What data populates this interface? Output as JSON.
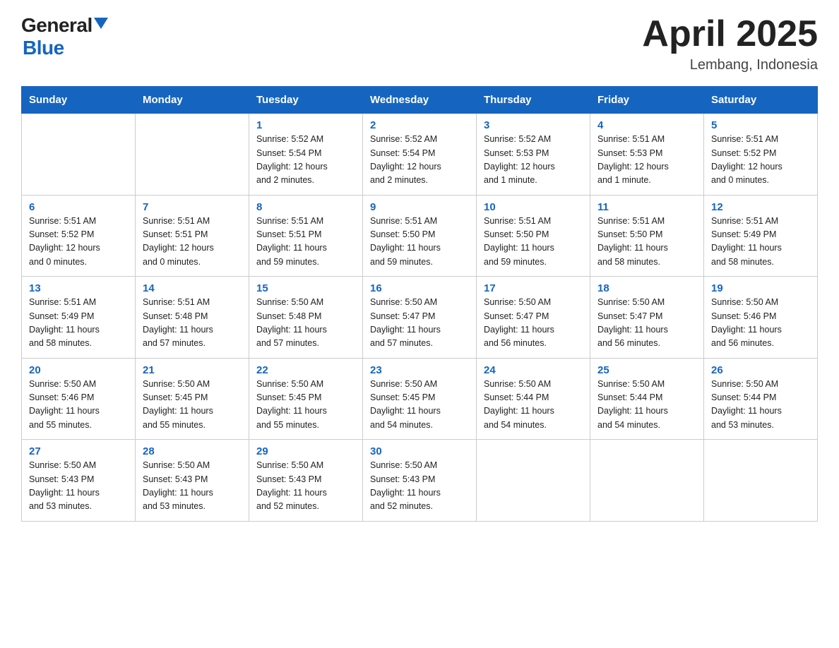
{
  "header": {
    "logo_general": "General",
    "logo_blue": "Blue",
    "title": "April 2025",
    "location": "Lembang, Indonesia"
  },
  "weekdays": [
    "Sunday",
    "Monday",
    "Tuesday",
    "Wednesday",
    "Thursday",
    "Friday",
    "Saturday"
  ],
  "weeks": [
    [
      {
        "day": "",
        "info": ""
      },
      {
        "day": "",
        "info": ""
      },
      {
        "day": "1",
        "info": "Sunrise: 5:52 AM\nSunset: 5:54 PM\nDaylight: 12 hours\nand 2 minutes."
      },
      {
        "day": "2",
        "info": "Sunrise: 5:52 AM\nSunset: 5:54 PM\nDaylight: 12 hours\nand 2 minutes."
      },
      {
        "day": "3",
        "info": "Sunrise: 5:52 AM\nSunset: 5:53 PM\nDaylight: 12 hours\nand 1 minute."
      },
      {
        "day": "4",
        "info": "Sunrise: 5:51 AM\nSunset: 5:53 PM\nDaylight: 12 hours\nand 1 minute."
      },
      {
        "day": "5",
        "info": "Sunrise: 5:51 AM\nSunset: 5:52 PM\nDaylight: 12 hours\nand 0 minutes."
      }
    ],
    [
      {
        "day": "6",
        "info": "Sunrise: 5:51 AM\nSunset: 5:52 PM\nDaylight: 12 hours\nand 0 minutes."
      },
      {
        "day": "7",
        "info": "Sunrise: 5:51 AM\nSunset: 5:51 PM\nDaylight: 12 hours\nand 0 minutes."
      },
      {
        "day": "8",
        "info": "Sunrise: 5:51 AM\nSunset: 5:51 PM\nDaylight: 11 hours\nand 59 minutes."
      },
      {
        "day": "9",
        "info": "Sunrise: 5:51 AM\nSunset: 5:50 PM\nDaylight: 11 hours\nand 59 minutes."
      },
      {
        "day": "10",
        "info": "Sunrise: 5:51 AM\nSunset: 5:50 PM\nDaylight: 11 hours\nand 59 minutes."
      },
      {
        "day": "11",
        "info": "Sunrise: 5:51 AM\nSunset: 5:50 PM\nDaylight: 11 hours\nand 58 minutes."
      },
      {
        "day": "12",
        "info": "Sunrise: 5:51 AM\nSunset: 5:49 PM\nDaylight: 11 hours\nand 58 minutes."
      }
    ],
    [
      {
        "day": "13",
        "info": "Sunrise: 5:51 AM\nSunset: 5:49 PM\nDaylight: 11 hours\nand 58 minutes."
      },
      {
        "day": "14",
        "info": "Sunrise: 5:51 AM\nSunset: 5:48 PM\nDaylight: 11 hours\nand 57 minutes."
      },
      {
        "day": "15",
        "info": "Sunrise: 5:50 AM\nSunset: 5:48 PM\nDaylight: 11 hours\nand 57 minutes."
      },
      {
        "day": "16",
        "info": "Sunrise: 5:50 AM\nSunset: 5:47 PM\nDaylight: 11 hours\nand 57 minutes."
      },
      {
        "day": "17",
        "info": "Sunrise: 5:50 AM\nSunset: 5:47 PM\nDaylight: 11 hours\nand 56 minutes."
      },
      {
        "day": "18",
        "info": "Sunrise: 5:50 AM\nSunset: 5:47 PM\nDaylight: 11 hours\nand 56 minutes."
      },
      {
        "day": "19",
        "info": "Sunrise: 5:50 AM\nSunset: 5:46 PM\nDaylight: 11 hours\nand 56 minutes."
      }
    ],
    [
      {
        "day": "20",
        "info": "Sunrise: 5:50 AM\nSunset: 5:46 PM\nDaylight: 11 hours\nand 55 minutes."
      },
      {
        "day": "21",
        "info": "Sunrise: 5:50 AM\nSunset: 5:45 PM\nDaylight: 11 hours\nand 55 minutes."
      },
      {
        "day": "22",
        "info": "Sunrise: 5:50 AM\nSunset: 5:45 PM\nDaylight: 11 hours\nand 55 minutes."
      },
      {
        "day": "23",
        "info": "Sunrise: 5:50 AM\nSunset: 5:45 PM\nDaylight: 11 hours\nand 54 minutes."
      },
      {
        "day": "24",
        "info": "Sunrise: 5:50 AM\nSunset: 5:44 PM\nDaylight: 11 hours\nand 54 minutes."
      },
      {
        "day": "25",
        "info": "Sunrise: 5:50 AM\nSunset: 5:44 PM\nDaylight: 11 hours\nand 54 minutes."
      },
      {
        "day": "26",
        "info": "Sunrise: 5:50 AM\nSunset: 5:44 PM\nDaylight: 11 hours\nand 53 minutes."
      }
    ],
    [
      {
        "day": "27",
        "info": "Sunrise: 5:50 AM\nSunset: 5:43 PM\nDaylight: 11 hours\nand 53 minutes."
      },
      {
        "day": "28",
        "info": "Sunrise: 5:50 AM\nSunset: 5:43 PM\nDaylight: 11 hours\nand 53 minutes."
      },
      {
        "day": "29",
        "info": "Sunrise: 5:50 AM\nSunset: 5:43 PM\nDaylight: 11 hours\nand 52 minutes."
      },
      {
        "day": "30",
        "info": "Sunrise: 5:50 AM\nSunset: 5:43 PM\nDaylight: 11 hours\nand 52 minutes."
      },
      {
        "day": "",
        "info": ""
      },
      {
        "day": "",
        "info": ""
      },
      {
        "day": "",
        "info": ""
      }
    ]
  ]
}
